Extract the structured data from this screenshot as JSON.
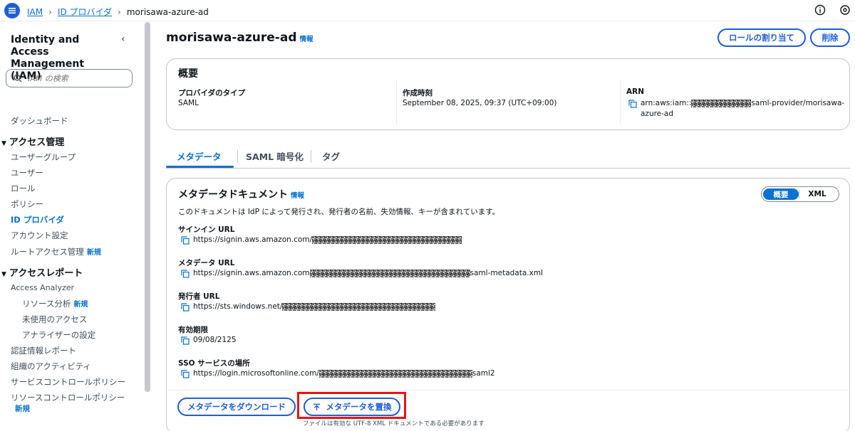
{
  "topbar": {
    "breadcrumbs": [
      "IAM",
      "ID プロバイダ",
      "morisawa-azure-ad"
    ]
  },
  "sidebar": {
    "title": "Identity and Access Management (IAM)",
    "search_placeholder": "IAM の検索",
    "dashboard": "ダッシュボード",
    "section_access": "アクセス管理",
    "access_items": [
      "ユーザーグループ",
      "ユーザー",
      "ロール",
      "ポリシー",
      "ID プロバイダ",
      "アカウント設定",
      "ルートアクセス管理"
    ],
    "section_reports": "アクセスレポート",
    "analyzer": "Access Analyzer",
    "analyzer_items": [
      "リソース分析",
      "未使用のアクセス",
      "アナライザーの設定"
    ],
    "report_items": [
      "認証情報レポート",
      "組織のアクティビティ",
      "サービスコントロールポリシー",
      "リソースコントロールポリシー"
    ],
    "new_badge": "新規"
  },
  "page": {
    "title": "morisawa-azure-ad",
    "info": "情報",
    "btn_assign_role": "ロールの割り当て",
    "btn_delete": "削除"
  },
  "overview": {
    "heading": "概要",
    "provider_type_label": "プロバイダのタイプ",
    "provider_type_value": "SAML",
    "created_label": "作成時刻",
    "created_value": "September 08, 2025, 09:37 (UTC+09:00)",
    "arn_label": "ARN",
    "arn_prefix": "arn:aws:iam::",
    "arn_suffix": "saml-provider/morisawa-",
    "arn_suffix2": "azure-ad"
  },
  "tabs": [
    "メタデータ",
    "SAML 暗号化",
    "タグ"
  ],
  "metadata": {
    "heading": "メタデータドキュメント",
    "info": "情報",
    "toggle_on": "概要",
    "toggle_off": "XML",
    "description": "このドキュメントは IdP によって発行され、発行者の名前、失効情報、キーが含まれています。",
    "signin_label": "サインイン URL",
    "signin_value": "https://signin.aws.amazon.com/",
    "metadata_url_label": "メタデータ URL",
    "metadata_url_value": "https://signin.aws.amazon.com",
    "metadata_url_suffix": "saml-metadata.xml",
    "issuer_label": "発行者 URL",
    "issuer_value": "https://sts.windows.net/",
    "expiry_label": "有効期限",
    "expiry_value": "09/08/2125",
    "sso_label": "SSO サービスの場所",
    "sso_value": "https://login.microsoftonline.com/",
    "sso_suffix": "saml2",
    "btn_download": "メタデータをダウンロード",
    "btn_replace": "メタデータを置換",
    "note": "ファイルは有効な UTF-8 XML ドキュメントである必要があります"
  }
}
